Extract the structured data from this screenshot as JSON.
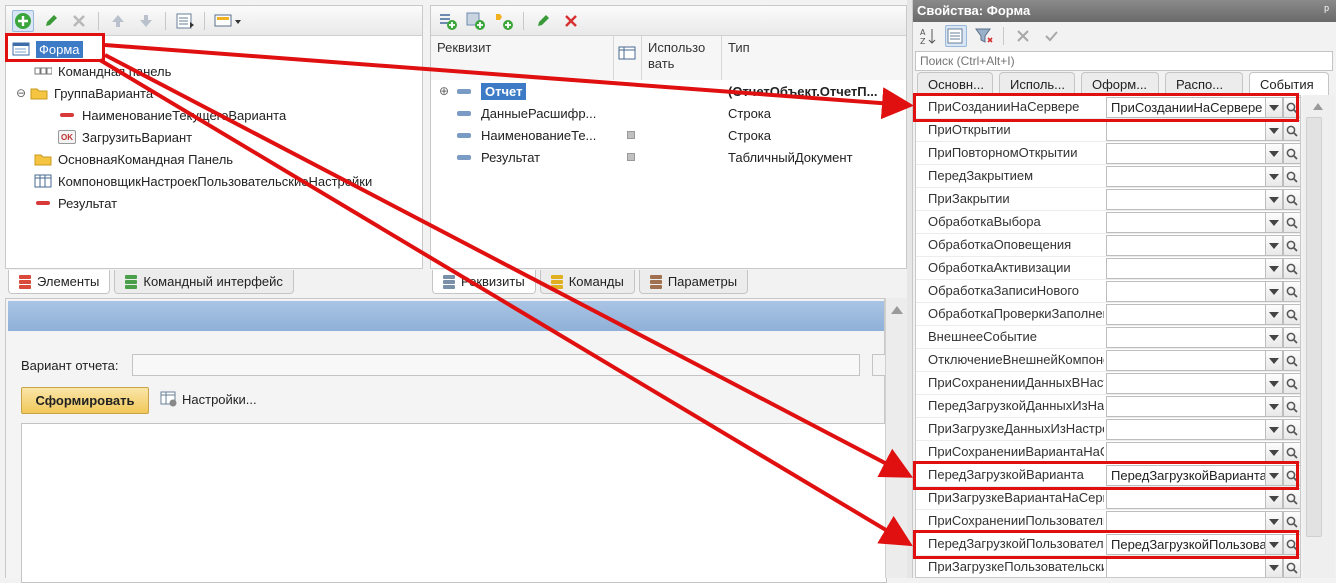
{
  "elements_panel": {
    "tree": [
      {
        "label": "Форма",
        "icon": "form-icon",
        "selected": true
      },
      {
        "label": "Командная панель",
        "icon": "command-panel-icon"
      },
      {
        "label": "ГруппаВарианта",
        "icon": "folder-icon"
      },
      {
        "label": "НаименованиеТекущегоВарианта",
        "icon": "field-icon"
      },
      {
        "label": "ЗагрузитьВариант",
        "icon": "ok-button-icon",
        "icon_text": "OK"
      },
      {
        "label": "ОсновнаяКомандная Панель",
        "icon": "folder-icon"
      },
      {
        "label": "КомпоновщикНастроекПользовательскиеНастройки",
        "icon": "table-icon"
      },
      {
        "label": "Результат",
        "icon": "field-icon"
      }
    ],
    "tabs": [
      "Элементы",
      "Командный интерфейс"
    ]
  },
  "attributes_panel": {
    "columns": {
      "attr": "Реквизит",
      "use": "Использо вать",
      "type": "Тип"
    },
    "rows": [
      {
        "name": "Отчет",
        "type": "(ОтчетОбъект.ОтчетП...",
        "bold": true
      },
      {
        "name": "ДанныеРасшифр...",
        "type": "Строка"
      },
      {
        "name": "НаименованиеТе...",
        "type": "Строка"
      },
      {
        "name": "Результат",
        "type": "ТабличныйДокумент"
      }
    ],
    "tabs": [
      "Реквизиты",
      "Команды",
      "Параметры"
    ]
  },
  "preview": {
    "variant_label": "Вариант отчета:",
    "generate_button": "Сформировать",
    "settings_label": "Настройки..."
  },
  "properties": {
    "title": "Свойства: Форма",
    "pin": "ᵖ",
    "search_placeholder": "Поиск (Ctrl+Alt+I)",
    "tabs": [
      "Основн...",
      "Исполь...",
      "Оформ...",
      "Распо...",
      "События"
    ],
    "events": [
      {
        "name": "ПриСозданииНаСервере",
        "value": "ПриСозданииНаСервере",
        "highlight": true
      },
      {
        "name": "ПриОткрытии",
        "value": ""
      },
      {
        "name": "ПриПовторномОткрытии",
        "value": ""
      },
      {
        "name": "ПередЗакрытием",
        "value": ""
      },
      {
        "name": "ПриЗакрытии",
        "value": ""
      },
      {
        "name": "ОбработкаВыбора",
        "value": ""
      },
      {
        "name": "ОбработкаОповещения",
        "value": ""
      },
      {
        "name": "ОбработкаАктивизации",
        "value": ""
      },
      {
        "name": "ОбработкаЗаписиНового",
        "value": ""
      },
      {
        "name": "ОбработкаПроверкиЗаполнения",
        "value": ""
      },
      {
        "name": "ВнешнееСобытие",
        "value": ""
      },
      {
        "name": "ОтключениеВнешнейКомпоненты",
        "value": ""
      },
      {
        "name": "ПриСохраненииДанныхВНастройках",
        "value": ""
      },
      {
        "name": "ПередЗагрузкойДанныхИзНастроек",
        "value": ""
      },
      {
        "name": "ПриЗагрузкеДанныхИзНастроек",
        "value": ""
      },
      {
        "name": "ПриСохраненииВариантаНаСервере",
        "value": ""
      },
      {
        "name": "ПередЗагрузкойВарианта",
        "value": "ПередЗагрузкойВарианта",
        "highlight": true
      },
      {
        "name": "ПриЗагрузкеВариантаНаСервере",
        "value": ""
      },
      {
        "name": "ПриСохраненииПользовательских",
        "value": ""
      },
      {
        "name": "ПередЗагрузкойПользовательских",
        "value": "ПередЗагрузкойПользовательских",
        "highlight": true
      },
      {
        "name": "ПриЗагрузкеПользовательских",
        "value": ""
      }
    ]
  },
  "colors": {
    "highlight": "#e01010",
    "selection": "#3d7bc7"
  }
}
